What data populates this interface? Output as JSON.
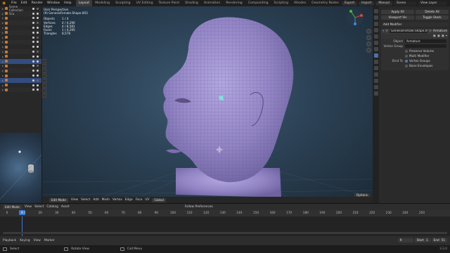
{
  "topbar": {
    "menus": [
      "File",
      "Edit",
      "Render",
      "Window",
      "Help"
    ],
    "workspaces": [
      "Layout",
      "Modeling",
      "Sculpting",
      "UV Editing",
      "Texture Paint",
      "Shading",
      "Animation",
      "Rendering",
      "Compositing",
      "Scripting",
      "Altodes",
      "Geometry Nodes"
    ],
    "active_workspace": "Layout",
    "right": {
      "export": "Export",
      "import": "Import",
      "manual": "Manual",
      "scene_label": "Scene",
      "view_layer_label": "View Layer"
    }
  },
  "outliner": {
    "rows": [
      {
        "label": "Scene Collection",
        "selected": false
      },
      {
        "label": "Sca",
        "selected": false
      },
      {
        "label": "",
        "selected": false
      },
      {
        "label": "",
        "selected": false
      },
      {
        "label": "",
        "selected": false
      },
      {
        "label": "",
        "selected": false
      },
      {
        "label": "",
        "selected": false
      },
      {
        "label": "",
        "selected": false
      },
      {
        "label": "",
        "selected": false
      },
      {
        "label": "",
        "selected": false
      },
      {
        "label": "",
        "selected": false
      },
      {
        "label": "",
        "selected": true
      },
      {
        "label": "",
        "selected": false
      },
      {
        "label": "",
        "selected": false
      },
      {
        "label": "",
        "selected": false
      },
      {
        "label": "",
        "selected": true
      },
      {
        "label": "",
        "selected": false
      },
      {
        "label": "",
        "selected": false
      }
    ]
  },
  "viewport": {
    "info": {
      "view": "User Perspective",
      "object": "(9) GenesisFemale.Shape.003",
      "stats": [
        {
          "k": "Objects",
          "v": "1 / 4"
        },
        {
          "k": "Vertices",
          "v": "4 / 4,290"
        },
        {
          "k": "Edges",
          "v": "4 / 8,581"
        },
        {
          "k": "Faces",
          "v": "1 / 4,295"
        },
        {
          "k": "Triangles",
          "v": "8,578"
        }
      ]
    },
    "bottom": {
      "mode": "Edit Mode",
      "menus": [
        "View",
        "Select",
        "Add",
        "Mesh",
        "Vertex",
        "Edge",
        "Face",
        "UV"
      ],
      "transform": "Global",
      "options": "Options"
    }
  },
  "properties": {
    "top_buttons": [
      [
        "Apply All",
        "Delete All"
      ],
      [
        "Viewport Vis",
        "Toggle Stack"
      ]
    ],
    "add_modifier": "Add Modifier",
    "modifier": {
      "object_name": "GenesisFemale.Shape.003",
      "type_label": "Armature",
      "fields": [
        {
          "label": "Object",
          "value": "Armature"
        },
        {
          "label": "Vertex Group",
          "value": ""
        }
      ],
      "checks": [
        {
          "label": "",
          "text": "Preserve Volume",
          "on": false
        },
        {
          "label": "",
          "text": "Multi Modifier",
          "on": false
        },
        {
          "label": "Bind To",
          "text": "Vertex Groups",
          "on": true
        },
        {
          "label": "",
          "text": "Bone Envelopes",
          "on": false
        }
      ]
    }
  },
  "timeline": {
    "header": {
      "mode": "Edit Mode",
      "menus": [
        "View",
        "Select",
        "Catalog",
        "Asset"
      ],
      "follow": "Follow Preferences"
    },
    "ticks": [
      0,
      10,
      20,
      30,
      40,
      50,
      60,
      70,
      80,
      90,
      100,
      110,
      120,
      130,
      140,
      150,
      160,
      170,
      180,
      190,
      200,
      210,
      220,
      230,
      240,
      250
    ],
    "current_frame": "9",
    "footer": {
      "menus": [
        "Playback",
        "Keying",
        "View",
        "Marker"
      ]
    },
    "frames": {
      "current": "9",
      "start_label": "Start",
      "start": "1",
      "end_label": "End",
      "end": "51"
    }
  },
  "status": {
    "select": "Select",
    "rotate": "Rotate View",
    "call_menu": "Call Menu",
    "version": "3.3.0"
  },
  "colors": {
    "accent": "#3b7ad6",
    "mesh": "#9b8fd0",
    "selected_face": "#7ee0e0"
  }
}
